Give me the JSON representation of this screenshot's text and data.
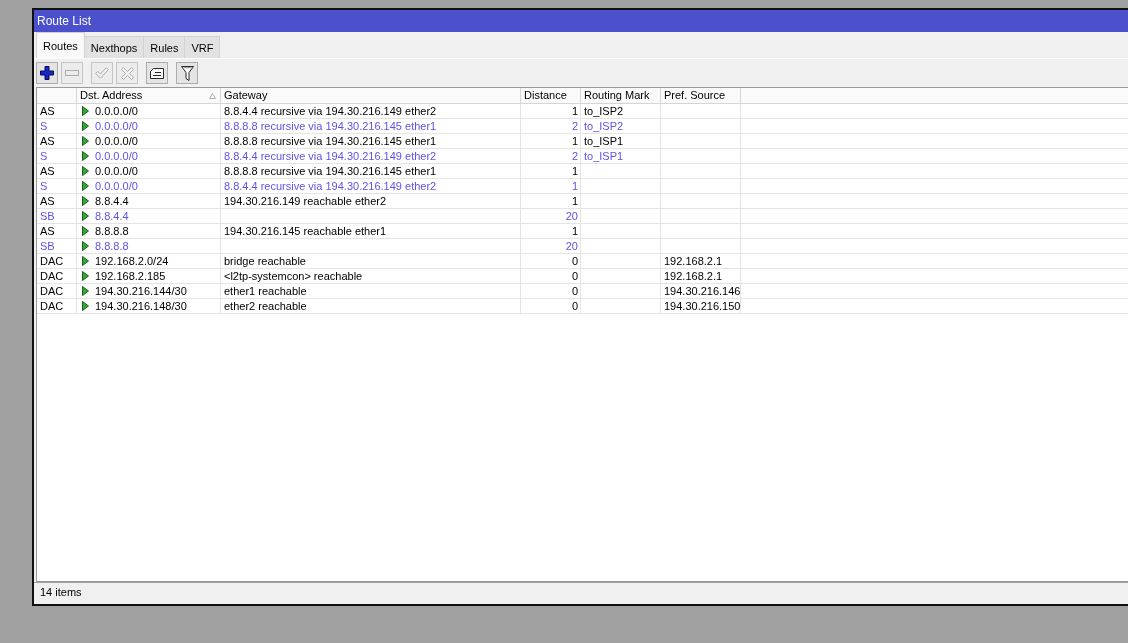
{
  "window": {
    "title": "Route List"
  },
  "tabs": [
    {
      "label": "Routes",
      "selected": true
    },
    {
      "label": "Nexthops",
      "selected": false
    },
    {
      "label": "Rules",
      "selected": false
    },
    {
      "label": "VRF",
      "selected": false
    }
  ],
  "toolbar": [
    {
      "buttons": [
        {
          "kind": "add",
          "disabled": false
        },
        {
          "kind": "remove",
          "disabled": true
        }
      ]
    },
    {
      "buttons": [
        {
          "kind": "enable",
          "disabled": true
        },
        {
          "kind": "disable",
          "disabled": true
        }
      ]
    },
    {
      "buttons": [
        {
          "kind": "comment",
          "disabled": false
        }
      ]
    },
    {
      "buttons": [
        {
          "kind": "filter",
          "disabled": false
        }
      ]
    }
  ],
  "table": {
    "columns": [
      {
        "label": "Dst. Address",
        "sorted": true
      },
      {
        "label": "Gateway",
        "sorted": false
      },
      {
        "label": "Distance",
        "sorted": false
      },
      {
        "label": "Routing Mark",
        "sorted": false
      },
      {
        "label": "Pref. Source",
        "sorted": false
      }
    ],
    "rows": [
      {
        "flags": "AS",
        "dst": "0.0.0.0/0",
        "gateway": "8.8.4.4 recursive via 194.30.216.149 ether2",
        "distance": "1",
        "routing_mark": "to_ISP2",
        "active": true
      },
      {
        "flags": "S",
        "dst": "0.0.0.0/0",
        "gateway": "8.8.8.8 recursive via 194.30.216.145 ether1",
        "distance": "2",
        "routing_mark": "to_ISP2",
        "active": false
      },
      {
        "flags": "AS",
        "dst": "0.0.0.0/0",
        "gateway": "8.8.8.8 recursive via 194.30.216.145 ether1",
        "distance": "1",
        "routing_mark": "to_ISP1",
        "active": true
      },
      {
        "flags": "S",
        "dst": "0.0.0.0/0",
        "gateway": "8.8.4.4 recursive via 194.30.216.149 ether2",
        "distance": "2",
        "routing_mark": "to_ISP1",
        "active": false
      },
      {
        "flags": "AS",
        "dst": "0.0.0.0/0",
        "gateway": "8.8.8.8 recursive via 194.30.216.145 ether1",
        "distance": "1",
        "active": true
      },
      {
        "flags": "S",
        "dst": "0.0.0.0/0",
        "gateway": "8.8.4.4 recursive via 194.30.216.149 ether2",
        "distance": "1",
        "active": false
      },
      {
        "flags": "AS",
        "dst": "8.8.4.4",
        "gateway": "194.30.216.149 reachable ether2",
        "distance": "1",
        "active": true
      },
      {
        "flags": "SB",
        "dst": "8.8.4.4",
        "distance": "20",
        "active": false
      },
      {
        "flags": "AS",
        "dst": "8.8.8.8",
        "gateway": "194.30.216.145 reachable ether1",
        "distance": "1",
        "active": true
      },
      {
        "flags": "SB",
        "dst": "8.8.8.8",
        "distance": "20",
        "active": false
      },
      {
        "flags": "DAC",
        "dst": "192.168.2.0/24",
        "gateway": "bridge reachable",
        "distance": "0",
        "pref_source": "192.168.2.1",
        "active": true
      },
      {
        "flags": "DAC",
        "dst": "192.168.2.185",
        "gateway": "<l2tp-systemcon> reachable",
        "distance": "0",
        "pref_source": "192.168.2.1",
        "active": true
      },
      {
        "flags": "DAC",
        "dst": "194.30.216.144/30",
        "gateway": "ether1 reachable",
        "distance": "0",
        "pref_source": "194.30.216.146",
        "active": true
      },
      {
        "flags": "DAC",
        "dst": "194.30.216.148/30",
        "gateway": "ether2 reachable",
        "distance": "0",
        "pref_source": "194.30.216.150",
        "active": true
      }
    ]
  },
  "status_bar": {
    "text": "14 items"
  }
}
